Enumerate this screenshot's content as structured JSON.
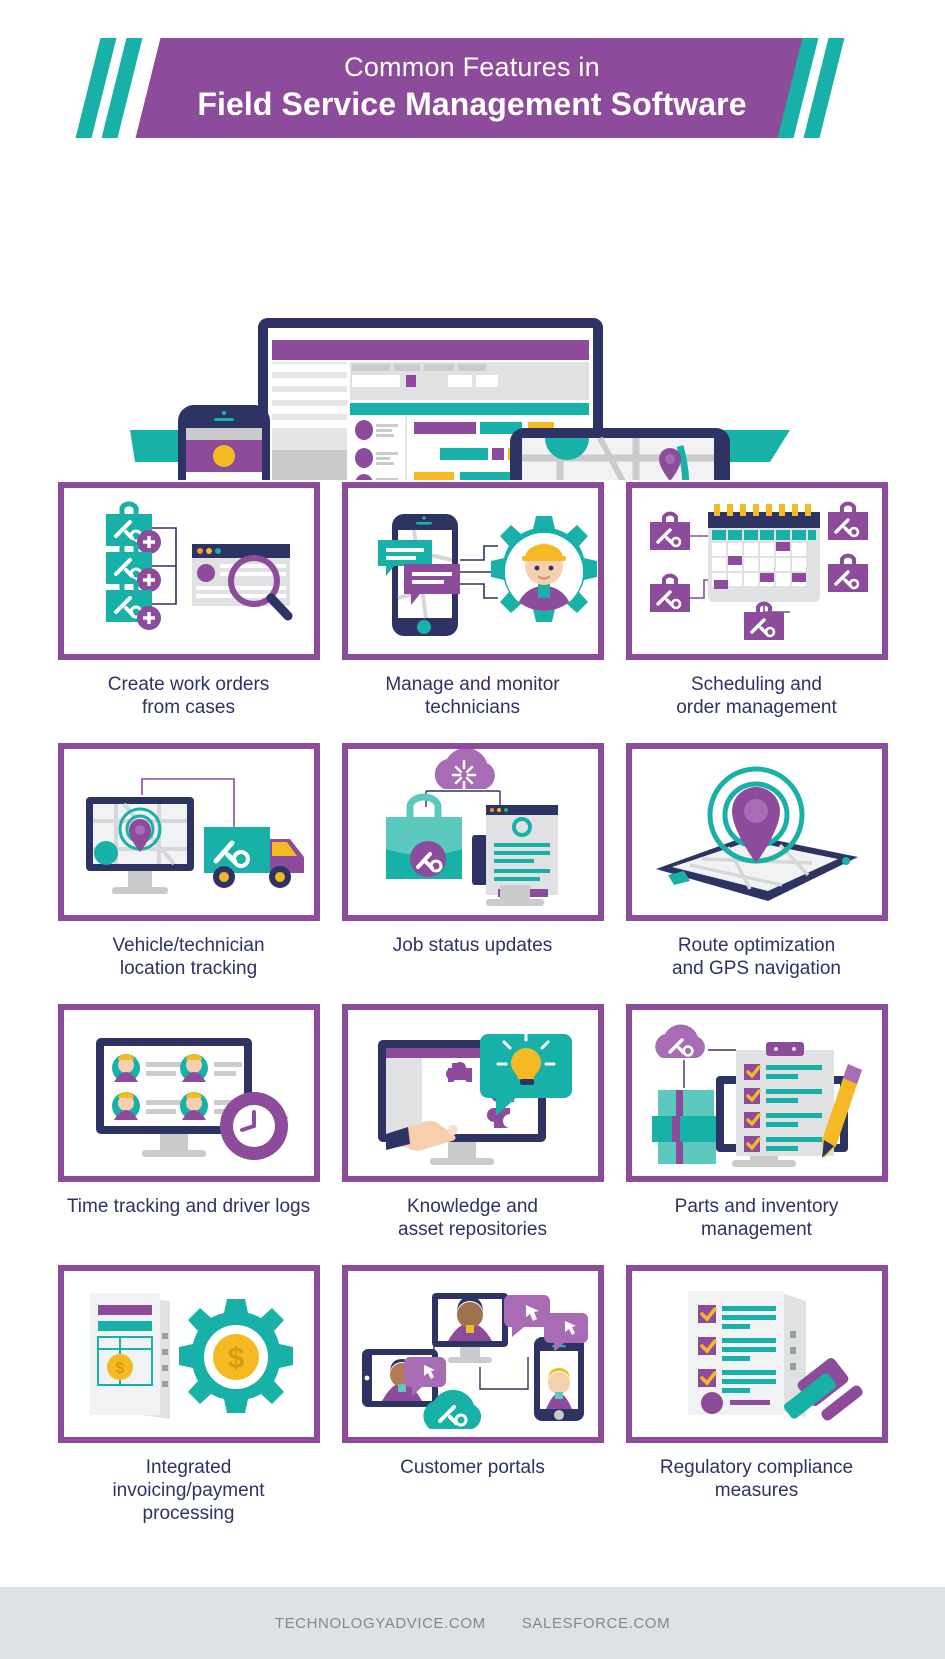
{
  "colors": {
    "purple": "#8c4b9b",
    "purple_light": "#a86cb5",
    "teal": "#17b1a8",
    "teal_light": "#5cc9bf",
    "navy": "#2d3362",
    "yellow": "#f5b923",
    "grey": "#c9cbcc",
    "grey_light": "#e4e6e7",
    "footer_bg": "#dde3e4",
    "footer_text": "#808a8c",
    "white": "#ffffff"
  },
  "header": {
    "title_line1": "Common Features in",
    "title_line2": "Field Service Management Software",
    "slash_icon": "slash-mark"
  },
  "hero": {
    "name": "devices-illustration",
    "devices": [
      "desktop-monitor-dashboard",
      "smartphone-app",
      "tablet-map"
    ]
  },
  "cards": [
    {
      "id": "create-work-orders",
      "caption": "Create work orders\nfrom cases",
      "icon": "toolboxes-to-browser-search-icon"
    },
    {
      "id": "manage-monitor-technicians",
      "caption": "Manage and monitor\ntechnicians",
      "icon": "phone-chat-technician-gear-icon"
    },
    {
      "id": "scheduling-order-management",
      "caption": "Scheduling and\norder management",
      "icon": "calendar-toolboxes-icon"
    },
    {
      "id": "vehicle-technician-location-tracking",
      "caption": "Vehicle/technician\nlocation tracking",
      "icon": "monitor-map-pin-truck-icon"
    },
    {
      "id": "job-status-updates",
      "caption": "Job status updates",
      "icon": "cloud-toolbox-document-icon"
    },
    {
      "id": "route-optimization-gps",
      "caption": "Route optimization\nand GPS navigation",
      "icon": "gps-pin-signal-tablet-icon"
    },
    {
      "id": "time-tracking-driver-logs",
      "caption": "Time tracking and driver logs",
      "icon": "monitor-technicians-clock-icon"
    },
    {
      "id": "knowledge-asset-repositories",
      "caption": "Knowledge and\nasset repositories",
      "icon": "monitor-hand-puzzle-lightbulb-icon"
    },
    {
      "id": "parts-inventory-management",
      "caption": "Parts and inventory\nmanagement",
      "icon": "cloud-boxes-clipboard-pencil-icon"
    },
    {
      "id": "integrated-invoicing-payment",
      "caption": "Integrated\ninvoicing/payment\nprocessing",
      "icon": "invoice-dollar-gear-icon"
    },
    {
      "id": "customer-portals",
      "caption": "Customer portals",
      "icon": "customer-avatars-devices-cloud-icon"
    },
    {
      "id": "regulatory-compliance-measures",
      "caption": "Regulatory compliance\nmeasures",
      "icon": "checklist-gavel-icon"
    }
  ],
  "footer": {
    "links": [
      "TECHNOLOGYADVICE.COM",
      "SALESFORCE.COM"
    ]
  }
}
